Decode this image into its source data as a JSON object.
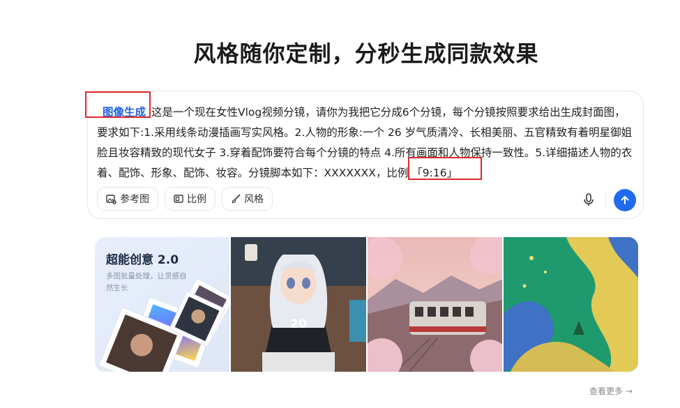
{
  "headline": "风格随你定制，分秒生成同款效果",
  "prompt": {
    "mode_tag": "图像生成",
    "text": "这是一个现在女性Vlog视频分镜，请你为我把它分成6个分镜，每个分镜按照要求给出生成封面图，要求如下:1.采用线条动漫插画写实风格。2.人物的形象:一个 26 岁气质清冷、长相美丽、五官精致有着明星御姐脸且妆容精致的现代女子 3.穿着配饰要符合每个分镜的特点 4.所有画面和人物保持一致性。5.详细描述人物的衣着、配饰、形象、配饰、妆容。分镜脚本如下：XXXXXXX，",
    "ratio_text": "比例 「9:16」"
  },
  "tools": {
    "reference": "参考图",
    "ratio": "比例",
    "style": "风格"
  },
  "accent_color": "#1f6bf0",
  "highlight_color": "#e0262b",
  "promo": {
    "title": "超能创意 2.0",
    "subtitle": "多图批量处理，让灵感自然生长"
  },
  "see_more": "查看更多 →"
}
